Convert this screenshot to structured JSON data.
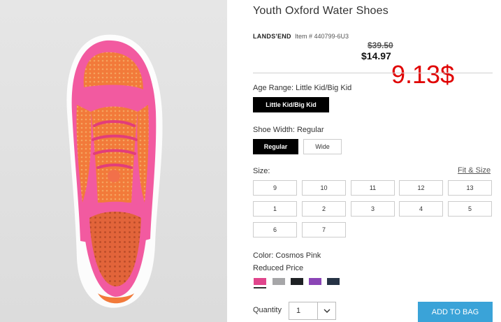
{
  "product": {
    "title": "Youth Oxford Water Shoes",
    "brand": "LANDS'END",
    "item_number": "Item # 440799-6U3",
    "price_original": "$39.50",
    "price_sale": "$14.97",
    "annotation": "9.13$"
  },
  "age_range": {
    "label": "Age Range: Little Kid/Big Kid",
    "options": [
      "Little Kid/Big Kid"
    ],
    "selected": "Little Kid/Big Kid"
  },
  "shoe_width": {
    "label": "Shoe Width: Regular",
    "options": [
      "Regular",
      "Wide"
    ],
    "selected": "Regular"
  },
  "size": {
    "label": "Size:",
    "fit_link": "Fit & Size",
    "options": [
      "9",
      "10",
      "11",
      "12",
      "13",
      "1",
      "2",
      "3",
      "4",
      "5",
      "6",
      "7"
    ]
  },
  "color": {
    "label": "Color: Cosmos Pink",
    "sublabel": "Reduced Price",
    "swatches": [
      "#e0458c",
      "#a6a6a8",
      "#1e2124",
      "#8b45b6",
      "#263345"
    ],
    "selected_index": 0
  },
  "quantity": {
    "label": "Quantity",
    "value": "1"
  },
  "add_to_bag": "ADD TO BAG"
}
